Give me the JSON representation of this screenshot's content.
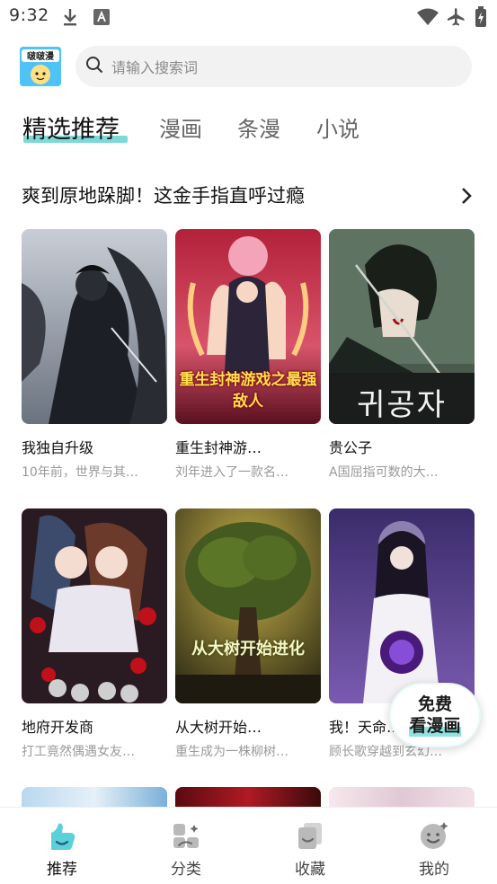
{
  "status_bar": {
    "time": "9:32",
    "icons": [
      "download-icon",
      "font-a-icon",
      "wifi-icon",
      "airplane-icon",
      "battery-charging-icon"
    ]
  },
  "header": {
    "logo_icon": "app-logo-icon",
    "search_placeholder": "请输入搜索词"
  },
  "tabs": [
    {
      "label": "精选推荐",
      "active": true
    },
    {
      "label": "漫画",
      "active": false
    },
    {
      "label": "条漫",
      "active": false
    },
    {
      "label": "小说",
      "active": false
    }
  ],
  "section": {
    "title": "爽到原地跺脚！这金手指直呼过瘾",
    "more_icon": "chevron-right-icon"
  },
  "cards": [
    {
      "title": "我独自升级",
      "desc": "10年前，世界与其…"
    },
    {
      "title": "重生封神游…",
      "desc": "刘年进入了一款名…",
      "cover_text": "重生封神游戏之最强敌人"
    },
    {
      "title": "贵公子",
      "desc": "A国屈指可数的大…",
      "cover_text": "귀공자"
    },
    {
      "title": "地府开发商",
      "desc": "打工竟然偶遇女友…"
    },
    {
      "title": "从大树开始…",
      "desc": "重生成为一株柳树…",
      "cover_text": "从大树开始进化"
    },
    {
      "title": "我！天命…",
      "desc": "顾长歌穿越到玄幻…"
    }
  ],
  "floating_button": {
    "line1": "免费",
    "line2": "看漫画"
  },
  "bottom_nav": [
    {
      "label": "推荐",
      "icon": "recommend-icon",
      "active": true
    },
    {
      "label": "分类",
      "icon": "category-icon",
      "active": false
    },
    {
      "label": "收藏",
      "icon": "favorites-icon",
      "active": false
    },
    {
      "label": "我的",
      "icon": "profile-icon",
      "active": false
    }
  ],
  "colors": {
    "accent": "#7fd8d8",
    "accent_dark": "#3fc7c7"
  }
}
